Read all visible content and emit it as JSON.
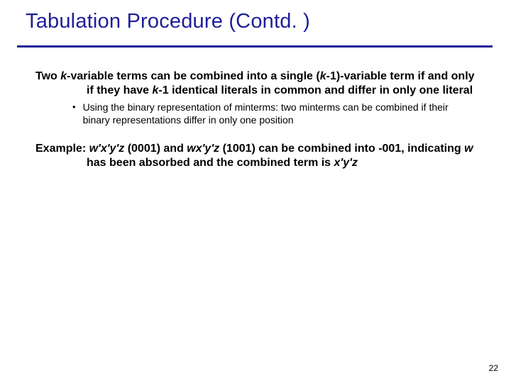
{
  "title": "Tabulation Procedure (Contd. )",
  "p1": {
    "pre": "Two ",
    "k1": "k",
    "mid1": "-variable terms can be combined into a single (",
    "k2": "k",
    "mid2": "-1)-variable term if and only if they have ",
    "k3": "k",
    "tail": "-1 identical literals in common and differ in only one literal"
  },
  "b1": "Using the binary representation of minterms: two minterms can be combined if their binary representations differ in only one position",
  "p2": {
    "pre": "Example: ",
    "t1": "w'x'y'z",
    "mid1": " (0001) and ",
    "t2": "wx'y'z",
    "mid2": " (1001) can be combined into -001, indicating ",
    "w": "w",
    "mid3": " has been absorbed and the combined term is ",
    "t3": "x'y'z"
  },
  "page": "22"
}
